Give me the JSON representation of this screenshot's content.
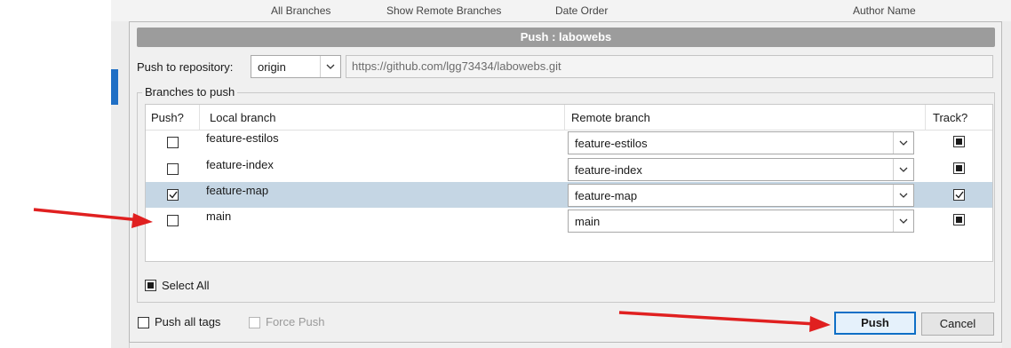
{
  "background": {
    "toolbar": {
      "branches_filter": "All Branches",
      "show_remote_label": "Show Remote Branches",
      "order_label": "Date Order",
      "author_label": "Author Name"
    }
  },
  "dialog": {
    "title": "Push : labowebs",
    "repository_label": "Push to repository:",
    "repository_value": "origin",
    "repository_url": "https://github.com/lgg73434/labowebs.git",
    "group_title": "Branches to push",
    "columns": {
      "push": "Push?",
      "local": "Local branch",
      "remote": "Remote branch",
      "track": "Track?"
    },
    "branches": [
      {
        "local": "feature-estilos",
        "remote": "feature-estilos",
        "push": false,
        "track": "indeterminate",
        "selected": false
      },
      {
        "local": "feature-index",
        "remote": "feature-index",
        "push": false,
        "track": "indeterminate",
        "selected": false
      },
      {
        "local": "feature-map",
        "remote": "feature-map",
        "push": true,
        "track": "checked",
        "selected": true
      },
      {
        "local": "main",
        "remote": "main",
        "push": false,
        "track": "indeterminate",
        "selected": false
      }
    ],
    "select_all_label": "Select All",
    "push_all_tags_label": "Push all tags",
    "force_push_label": "Force Push",
    "push_button": "Push",
    "cancel_button": "Cancel"
  },
  "colors": {
    "arrow": "#e02020",
    "selection": "#c5d6e4",
    "primary_border": "#0f6fc6"
  }
}
